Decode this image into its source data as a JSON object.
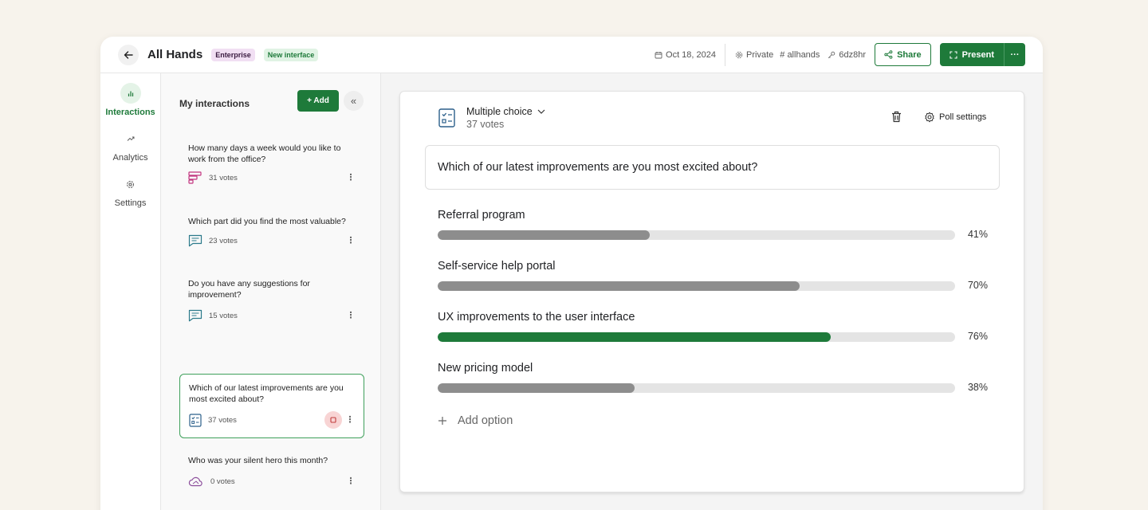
{
  "header": {
    "title": "All Hands",
    "badge_enterprise": "Enterprise",
    "badge_new": "New interface",
    "date": "Oct 18, 2024",
    "privacy": "Private",
    "channel": "# allhands",
    "code": "6dz8hr",
    "share_label": "Share",
    "present_label": "Present",
    "more_label": "···"
  },
  "nav": {
    "items": [
      {
        "label": "Interactions",
        "icon": "bar-chart-icon",
        "active": true
      },
      {
        "label": "Analytics",
        "icon": "trend-up-icon",
        "active": false
      },
      {
        "label": "Settings",
        "icon": "gear-icon",
        "active": false
      }
    ]
  },
  "panel": {
    "title": "My interactions",
    "add_label": "+ Add",
    "collapse_label": "«",
    "cards": [
      {
        "question": "How many days a week would you like to work from the office?",
        "votes": "31 votes",
        "icon": "ranking-icon"
      },
      {
        "question": "Which part did you find the most valuable?",
        "votes": "23 votes",
        "icon": "open-text-icon"
      },
      {
        "question": "Do you have any suggestions for improvement?",
        "votes": "15 votes",
        "icon": "open-text-icon"
      },
      {
        "question": "Which of our latest improvements are you most excited about?",
        "votes": "37 votes",
        "icon": "multiple-choice-icon",
        "selected": true
      },
      {
        "question": "Who was your silent hero this month?",
        "votes": "0 votes",
        "icon": "word-cloud-icon"
      }
    ]
  },
  "poll": {
    "type_label": "Multiple choice",
    "votes": "37 votes",
    "settings_label": "Poll settings",
    "question": "Which of our latest improvements are you most excited about?",
    "options": [
      {
        "label": "Referral program",
        "percent": 41,
        "percent_label": "41%"
      },
      {
        "label": "Self-service help portal",
        "percent": 70,
        "percent_label": "70%"
      },
      {
        "label": "UX improvements to the user interface",
        "percent": 76,
        "percent_label": "76%",
        "highlight": true
      },
      {
        "label": "New pricing model",
        "percent": 38,
        "percent_label": "38%"
      }
    ],
    "add_option_label": "Add option"
  },
  "colors": {
    "accent": "#1e7a3a",
    "bar_default": "#8d8d8d",
    "bar_track": "#e4e4e4"
  }
}
